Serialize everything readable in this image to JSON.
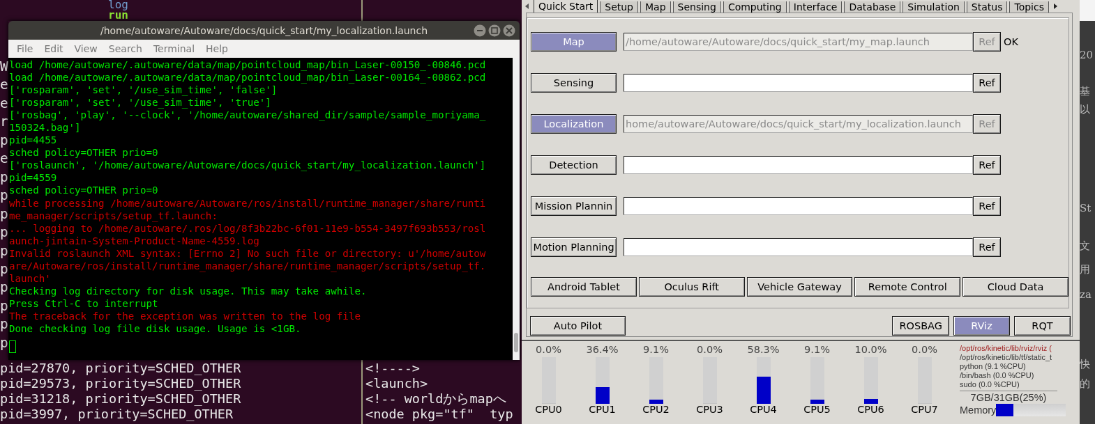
{
  "background_terminal": {
    "top_lines": [
      {
        "text": "log",
        "kind": "keyword"
      },
      {
        "text": "run",
        "kind": "command"
      }
    ],
    "left_edge": [
      "W",
      "e",
      "e",
      "r",
      "p",
      "e",
      "p",
      "p",
      "p",
      "p",
      "p",
      "p",
      "p",
      "p",
      "p",
      "p"
    ],
    "bottom_lines": [
      "pid=27870, priority=SCHED_OTHER",
      "pid=29573, priority=SCHED_OTHER",
      "pid=31218, priority=SCHED_OTHER",
      "pid=3997, priority=SCHED_OTHER"
    ],
    "right_lines": [
      "<!---->",
      "<launch>",
      "<!-- worldからmapへ",
      "<node pkg=\"tf\"  typ"
    ]
  },
  "terminal": {
    "title": "/home/autoware/Autoware/docs/quick_start/my_localization.launch",
    "menu": [
      "File",
      "Edit",
      "View",
      "Search",
      "Terminal",
      "Help"
    ],
    "lines": [
      {
        "text": "load /home/autoware/.autoware/data/map/pointcloud_map/bin_Laser-00150_-00846.pcd",
        "kind": "info"
      },
      {
        "text": "load /home/autoware/.autoware/data/map/pointcloud_map/bin_Laser-00164_-00862.pcd",
        "kind": "info"
      },
      {
        "text": "['rosparam', 'set', '/use_sim_time', 'false']",
        "kind": "info"
      },
      {
        "text": "['rosparam', 'set', '/use_sim_time', 'true']",
        "kind": "info"
      },
      {
        "text": "['rosbag', 'play', '--clock', '/home/autoware/shared_dir/sample/sample_moriyama_",
        "kind": "info"
      },
      {
        "text": "150324.bag']",
        "kind": "info"
      },
      {
        "text": "pid=4455",
        "kind": "info"
      },
      {
        "text": "sched policy=OTHER prio=0",
        "kind": "info"
      },
      {
        "text": "['roslaunch', '/home/autoware/Autoware/docs/quick_start/my_localization.launch']",
        "kind": "info"
      },
      {
        "text": "pid=4559",
        "kind": "info"
      },
      {
        "text": "sched policy=OTHER prio=0",
        "kind": "info"
      },
      {
        "text": "while processing /home/autoware/Autoware/ros/install/runtime_manager/share/runti",
        "kind": "error"
      },
      {
        "text": "me_manager/scripts/setup_tf.launch:",
        "kind": "error"
      },
      {
        "text": "... logging to /home/autoware/.ros/log/8f3b22bc-6f01-11e9-b554-3497f693b553/rosl",
        "kind": "error"
      },
      {
        "text": "aunch-jintain-System-Product-Name-4559.log",
        "kind": "error"
      },
      {
        "text": "Invalid roslaunch XML syntax: [Errno 2] No such file or directory: u'/home/autow",
        "kind": "error"
      },
      {
        "text": "are/Autoware/ros/install/runtime_manager/share/runtime_manager/scripts/setup_tf.",
        "kind": "error"
      },
      {
        "text": "launch'",
        "kind": "error"
      },
      {
        "text": "Checking log directory for disk usage. This may take awhile.",
        "kind": "info"
      },
      {
        "text": "Press Ctrl-C to interrupt",
        "kind": "info"
      },
      {
        "text": "The traceback for the exception was written to the log file",
        "kind": "error"
      },
      {
        "text": "Done checking log file disk usage. Usage is <1GB.",
        "kind": "info"
      }
    ]
  },
  "runtime_manager": {
    "tabs": [
      {
        "label": "Quick Start",
        "selected": true
      },
      {
        "label": "Setup",
        "selected": false
      },
      {
        "label": "Map",
        "selected": false
      },
      {
        "label": "Sensing",
        "selected": false
      },
      {
        "label": "Computing",
        "selected": false
      },
      {
        "label": "Interface",
        "selected": false
      },
      {
        "label": "Database",
        "selected": false
      },
      {
        "label": "Simulation",
        "selected": false
      },
      {
        "label": "Status",
        "selected": false
      },
      {
        "label": "Topics",
        "selected": false
      }
    ],
    "launch_rows": [
      {
        "label": "Map",
        "active": true,
        "path": "/home/autoware/Autoware/docs/quick_start/my_map.launch",
        "ref": "Ref",
        "status": "OK"
      },
      {
        "label": "Sensing",
        "active": false,
        "ref": "Ref"
      },
      {
        "label": "Localization",
        "active": true,
        "path": "home/autoware/Autoware/docs/quick_start/my_localization.launch",
        "ref": "Ref"
      },
      {
        "label": "Detection",
        "active": false,
        "ref": "Ref"
      },
      {
        "label": "Mission Plannin",
        "active": false,
        "ref": "Ref"
      },
      {
        "label": "Motion Planning",
        "active": false,
        "ref": "Ref"
      }
    ],
    "tools": [
      "Android Tablet",
      "Oculus Rift",
      "Vehicle Gateway",
      "Remote Control",
      "Cloud Data"
    ],
    "auto_pilot": "Auto Pilot",
    "right_buttons": [
      {
        "label": "ROSBAG",
        "selected": false
      },
      {
        "label": "RViz",
        "selected": true
      },
      {
        "label": "RQT",
        "selected": false
      }
    ],
    "cpus": [
      {
        "percent": "0.0%",
        "label": "CPU0",
        "level": 0
      },
      {
        "percent": "36.4%",
        "label": "CPU1",
        "level": 0.364
      },
      {
        "percent": "9.1%",
        "label": "CPU2",
        "level": 0.091
      },
      {
        "percent": "0.0%",
        "label": "CPU3",
        "level": 0
      },
      {
        "percent": "58.3%",
        "label": "CPU4",
        "level": 0.583
      },
      {
        "percent": "9.1%",
        "label": "CPU5",
        "level": 0.091
      },
      {
        "percent": "10.0%",
        "label": "CPU6",
        "level": 0.1
      },
      {
        "percent": "0.0%",
        "label": "CPU7",
        "level": 0
      }
    ],
    "processes": [
      {
        "text": "/opt/ros/kinetic/lib/rviz/rviz (",
        "kind": "top"
      },
      {
        "text": "/opt/ros/kinetic/lib/tf/static_t",
        "kind": "normal"
      },
      {
        "text": "python (9.1 %CPU)",
        "kind": "normal"
      },
      {
        "text": "/bin/bash (0.0 %CPU)",
        "kind": "normal"
      },
      {
        "text": "sudo (0.0 %CPU)",
        "kind": "normal"
      }
    ],
    "memory": {
      "reading": "7GB/31GB(25%)",
      "label": "Memory",
      "level": 0.25
    }
  },
  "side_strip": [
    "20",
    "基",
    "以",
    "St",
    "文",
    "用",
    "za",
    "快",
    "的"
  ]
}
